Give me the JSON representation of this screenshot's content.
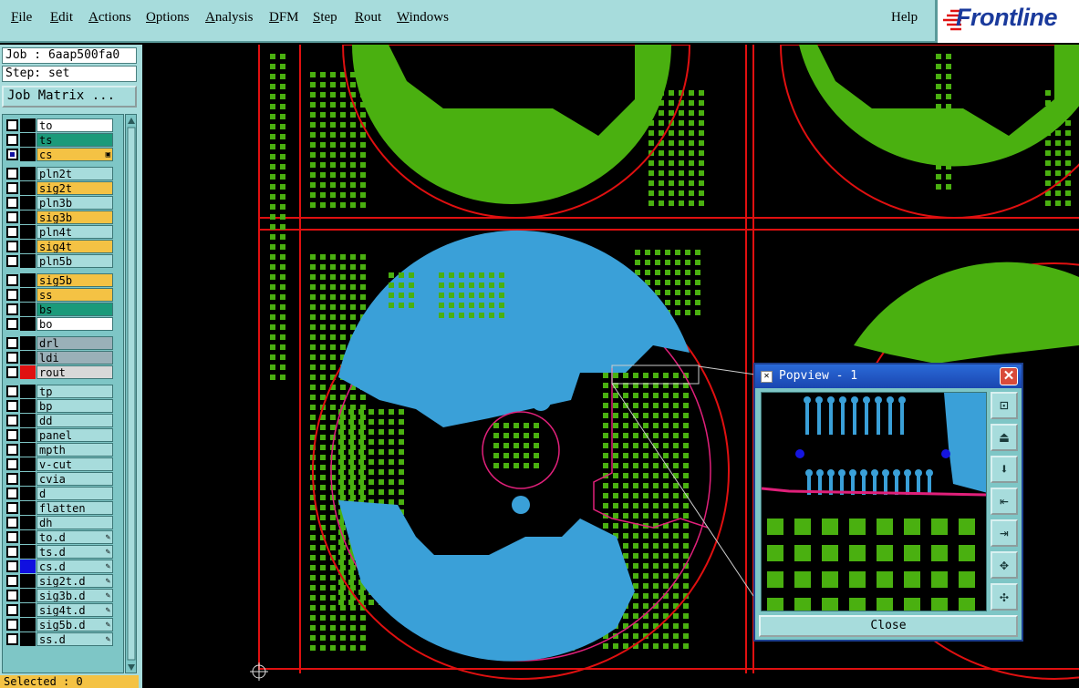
{
  "menubar": {
    "items": [
      "File",
      "Edit",
      "Actions",
      "Options",
      "Analysis",
      "DFM",
      "Step",
      "Rout",
      "Windows"
    ],
    "help": "Help",
    "logo": "Frontline"
  },
  "sidebar": {
    "job": "Job : 6aap500fa0",
    "step": "Step: set",
    "job_matrix": "Job Matrix ...",
    "layers": [
      {
        "name": "to",
        "color": "#ffffff",
        "swatch": "#000000"
      },
      {
        "name": "ts",
        "color": "#1b9a7a",
        "swatch": "#000000"
      },
      {
        "name": "cs",
        "color": "#f4c244",
        "swatch": "#000000",
        "selected": true,
        "mark": "▣"
      },
      {
        "name": "pln2t",
        "color": "#a7dcdc",
        "swatch": "#000000",
        "gap": true
      },
      {
        "name": "sig2t",
        "color": "#f4c244",
        "swatch": "#000000"
      },
      {
        "name": "pln3b",
        "color": "#a7dcdc",
        "swatch": "#000000"
      },
      {
        "name": "sig3b",
        "color": "#f4c244",
        "swatch": "#000000"
      },
      {
        "name": "pln4t",
        "color": "#a7dcdc",
        "swatch": "#000000"
      },
      {
        "name": "sig4t",
        "color": "#f4c244",
        "swatch": "#000000"
      },
      {
        "name": "pln5b",
        "color": "#a7dcdc",
        "swatch": "#000000"
      },
      {
        "name": "sig5b",
        "color": "#f4c244",
        "swatch": "#000000",
        "gap": true
      },
      {
        "name": "ss",
        "color": "#f4c244",
        "swatch": "#000000"
      },
      {
        "name": "bs",
        "color": "#1b9a7a",
        "swatch": "#000000"
      },
      {
        "name": "bo",
        "color": "#ffffff",
        "swatch": "#000000"
      },
      {
        "name": "drl",
        "color": "#9ab0b8",
        "swatch": "#000000",
        "gap": true
      },
      {
        "name": "ldi",
        "color": "#9ab0b8",
        "swatch": "#000000"
      },
      {
        "name": "rout",
        "color": "#d8d8d8",
        "swatch": "#e01010"
      },
      {
        "name": "tp",
        "color": "#a7dcdc",
        "swatch": "#000000",
        "gap": true
      },
      {
        "name": "bp",
        "color": "#a7dcdc",
        "swatch": "#000000"
      },
      {
        "name": "dd",
        "color": "#a7dcdc",
        "swatch": "#000000"
      },
      {
        "name": "panel",
        "color": "#a7dcdc",
        "swatch": "#000000"
      },
      {
        "name": "mpth",
        "color": "#a7dcdc",
        "swatch": "#000000"
      },
      {
        "name": "v-cut",
        "color": "#a7dcdc",
        "swatch": "#000000"
      },
      {
        "name": "cvia",
        "color": "#a7dcdc",
        "swatch": "#000000"
      },
      {
        "name": "d",
        "color": "#a7dcdc",
        "swatch": "#000000"
      },
      {
        "name": "flatten",
        "color": "#a7dcdc",
        "swatch": "#000000"
      },
      {
        "name": "dh",
        "color": "#a7dcdc",
        "swatch": "#000000"
      },
      {
        "name": "to.d",
        "color": "#a7dcdc",
        "swatch": "#000000",
        "mark": "✎"
      },
      {
        "name": "ts.d",
        "color": "#a7dcdc",
        "swatch": "#000000",
        "mark": "✎"
      },
      {
        "name": "cs.d",
        "color": "#a7dcdc",
        "swatch": "#1010e0",
        "mark": "✎"
      },
      {
        "name": "sig2t.d",
        "color": "#a7dcdc",
        "swatch": "#000000",
        "mark": "✎"
      },
      {
        "name": "sig3b.d",
        "color": "#a7dcdc",
        "swatch": "#000000",
        "mark": "✎"
      },
      {
        "name": "sig4t.d",
        "color": "#a7dcdc",
        "swatch": "#000000",
        "mark": "✎"
      },
      {
        "name": "sig5b.d",
        "color": "#a7dcdc",
        "swatch": "#000000",
        "mark": "✎"
      },
      {
        "name": "ss.d",
        "color": "#a7dcdc",
        "swatch": "#000000",
        "mark": "✎"
      }
    ],
    "status": "Selected : 0"
  },
  "popview": {
    "title": "Popview - 1",
    "close": "Close",
    "tools": [
      "zoom-fit-icon",
      "pan-up-icon",
      "pan-down-icon",
      "pan-left-icon",
      "pan-right-icon",
      "zoom-out-icon",
      "move-icon"
    ]
  },
  "colors": {
    "outline": "#e01010",
    "copper": "#3aa0d8",
    "plane": "#4ab010",
    "pad": "#4ab010",
    "profile": "#e0207a"
  }
}
